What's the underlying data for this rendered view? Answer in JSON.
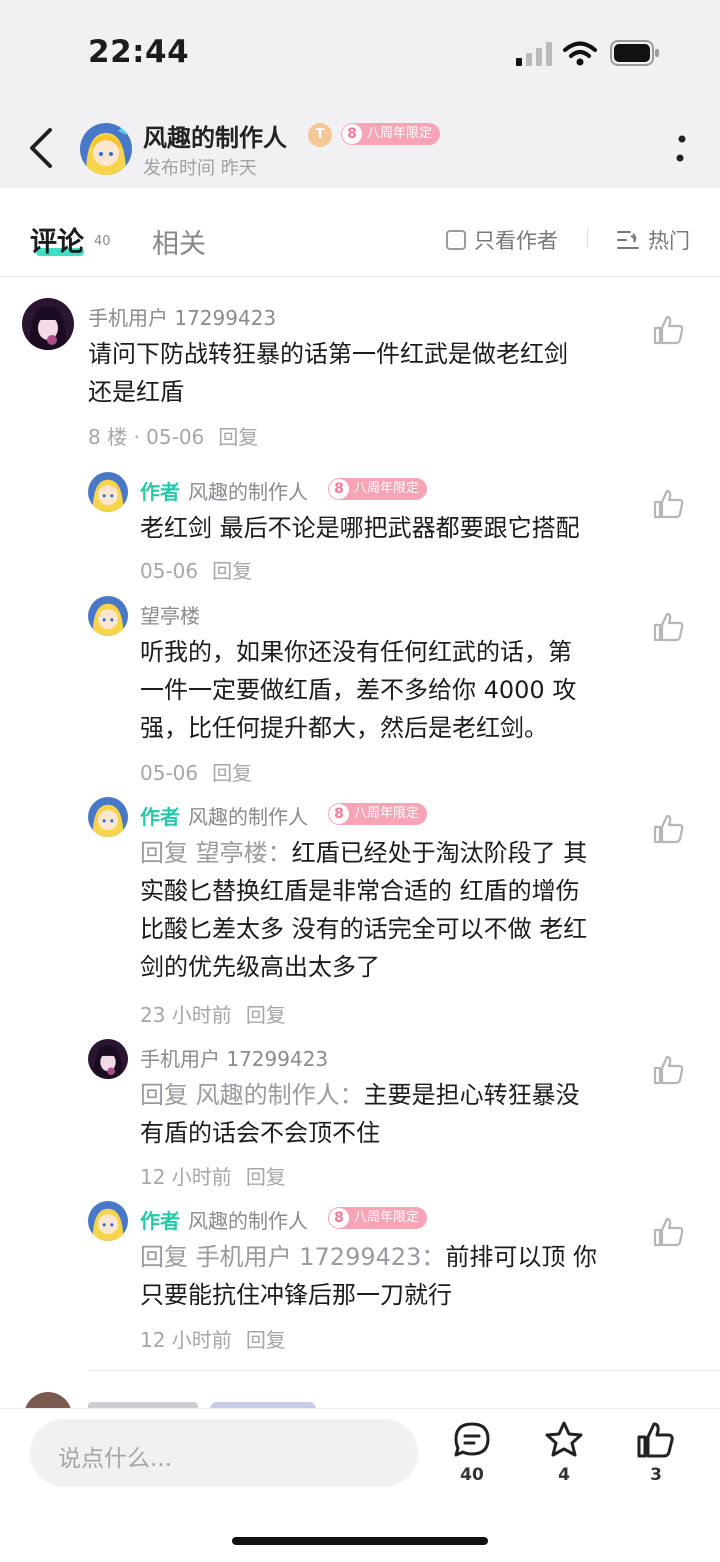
{
  "status_bar": {
    "time": "22:44"
  },
  "header": {
    "author_name": "风趣的制作人",
    "level_badge": "T",
    "anniv_badge_num": "8",
    "anniv_badge": "八周年限定",
    "publish_time": "发布时间 昨天"
  },
  "tabs": {
    "comments_label": "评论",
    "comments_count": "40",
    "related_label": "相关",
    "only_author_label": "只看作者",
    "sort_label": "热门"
  },
  "comments": [
    {
      "user": "手机用户 17299423",
      "lines": [
        "请问下防战转狂暴的话第一件红武是做老红剑",
        "还是红盾"
      ],
      "floor": "8 楼 · 05-06",
      "reply_label": "回复"
    }
  ],
  "replies": [
    {
      "author_tag": "作者",
      "user": "风趣的制作人",
      "badge": "八周年限定",
      "prefix": "",
      "lines": [
        "老红剑 最后不论是哪把武器都要跟它搭配"
      ],
      "time": "05-06",
      "reply_label": "回复"
    },
    {
      "user": "望亭楼",
      "lines": [
        "听我的，如果你还没有任何红武的话，第",
        "一件一定要做红盾，差不多给你 4000 攻",
        "强，比任何提升都大，然后是老红剑。"
      ],
      "time": "05-06",
      "reply_label": "回复"
    },
    {
      "author_tag": "作者",
      "user": "风趣的制作人",
      "badge": "八周年限定",
      "prefix": "回复 望亭楼：",
      "line1_rest": "红盾已经处于淘汰阶段了 其",
      "lines": [
        "实酸匕替换红盾是非常合适的 红盾的增伤",
        "比酸匕差太多 没有的话完全可以不做 老红",
        "剑的优先级高出太多了"
      ],
      "time": "23 小时前",
      "reply_label": "回复"
    },
    {
      "user": "手机用户 17299423",
      "prefix": "回复 风趣的制作人：",
      "line1_rest": "主要是担心转狂暴没",
      "lines": [
        "有盾的话会不会顶不住"
      ],
      "time": "12 小时前",
      "reply_label": "回复"
    },
    {
      "author_tag": "作者",
      "user": "风趣的制作人",
      "badge": "八周年限定",
      "prefix": "回复 手机用户 17299423：",
      "line1_rest": "前排可以顶 你",
      "lines": [
        "只要能抗住冲锋后那一刀就行"
      ],
      "time": "12 小时前",
      "reply_label": "回复"
    }
  ],
  "bottom_bar": {
    "input_placeholder": "说点什么...",
    "comment_count": "40",
    "favorite_count": "4",
    "like_count": "3"
  },
  "colors": {
    "accent": "#27c8a8",
    "badge": "#f7a4b7",
    "tab_underline": "#3ee0c5"
  }
}
